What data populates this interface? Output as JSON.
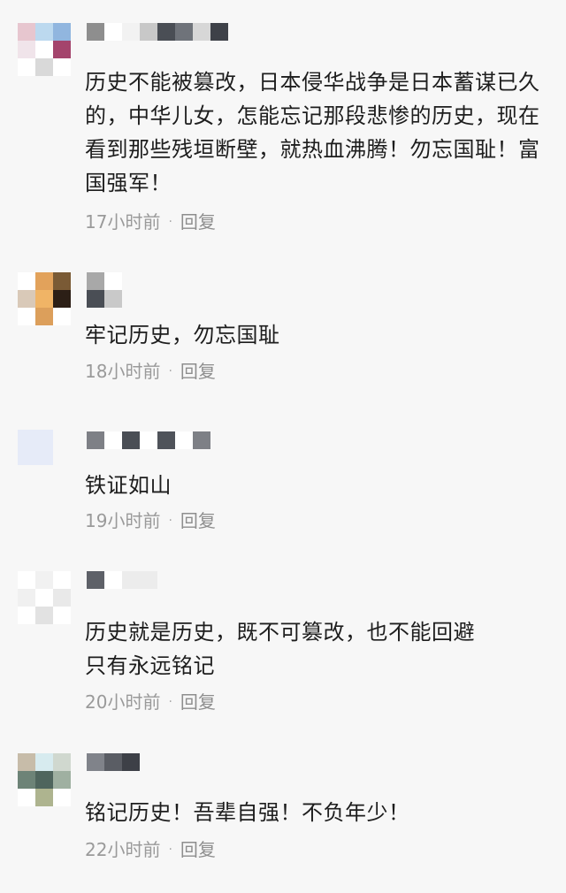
{
  "comments": [
    {
      "avatar_colors": [
        "#e7c6cf",
        "#bcd9ef",
        "#91b6df",
        "#f0e4ea",
        "#ffffff",
        "#a4446c",
        "#ffffff",
        "#d9d9d9",
        "#ffffff"
      ],
      "name_colors": [
        "#8e8e8e",
        "#ffffff",
        "#f2f2f2",
        "#c8c8c8",
        "#4a4e55",
        "#6f737a",
        "#d7d7d7",
        "#3e4148"
      ],
      "text": "历史不能被篡改，日本侵华战争是日本蓄谋已久的，中华儿女，怎能忘记那段悲惨的历史，现在看到那些残垣断壁，就热血沸腾！勿忘国耻！富国强军！",
      "time": "17小时前",
      "separator": "·",
      "reply": "回复"
    },
    {
      "avatar_colors": [
        "#ffffff",
        "#e2a25b",
        "#7a5a35",
        "#d9c9b8",
        "#f0b466",
        "#2c1f16",
        "#ffffff",
        "#dc9f5b",
        "#ffffff"
      ],
      "name_colors": [
        "#a8a8a8",
        "#ffffff",
        "#4a4e55",
        "#c9c9c9"
      ],
      "text": "牢记历史，勿忘国耻",
      "time": "18小时前",
      "separator": "·",
      "reply": "回复"
    },
    {
      "avatar_colors": [
        "#e6ebf8",
        "#e6ebf8",
        "#e6ebf8",
        "#e6ebf8"
      ],
      "name_colors": [
        "#7e8086",
        "#ffffff",
        "#4a4e55",
        "#ffffff",
        "#4f535a",
        "#ffffff",
        "#7e8086"
      ],
      "text": "铁证如山",
      "time": "19小时前",
      "separator": "·",
      "reply": "回复"
    },
    {
      "avatar_colors": [
        "#ffffff",
        "#f1f1f1",
        "#ffffff",
        "#f0f0f0",
        "#ffffff",
        "#e9e9e9",
        "#ffffff",
        "#e2e2e2",
        "#ffffff"
      ],
      "name_colors": [
        "#5e6168",
        "#ffffff",
        "#ececec",
        "#ececec"
      ],
      "text": "历史就是历史，既不可篡改，也不能回避\n只有永远铭记",
      "time": "20小时前",
      "separator": "·",
      "reply": "回复"
    },
    {
      "avatar_colors": [
        "#c7bca9",
        "#d7ebef",
        "#d0d8cf",
        "#6d8377",
        "#4f655d",
        "#9fb0a1",
        "#ffffff",
        "#aeb48f",
        "#ffffff"
      ],
      "name_colors": [
        "#80838a",
        "#5a5d64",
        "#3d4047"
      ],
      "text": "铭记历史！吾辈自强！不负年少！",
      "time": "22小时前",
      "separator": "·",
      "reply": "回复"
    }
  ]
}
